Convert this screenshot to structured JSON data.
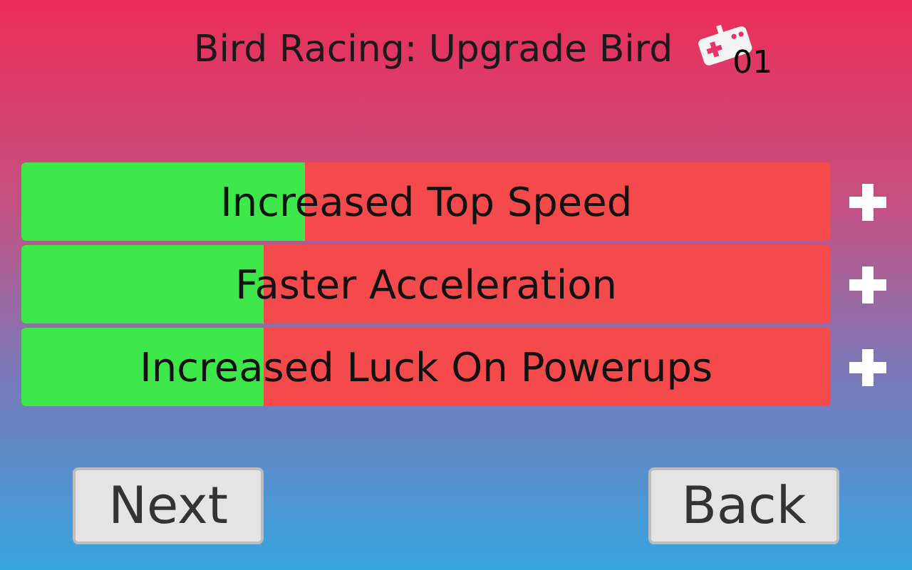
{
  "title": "Bird Racing: Upgrade Bird",
  "badge": "01",
  "upgrades": [
    {
      "label": "Increased Top Speed",
      "level": 0.35
    },
    {
      "label": "Faster Acceleration",
      "level": 0.3
    },
    {
      "label": "Increased Luck On Powerups",
      "level": 0.3
    }
  ],
  "buttons": [
    "Next",
    "Back"
  ]
}
